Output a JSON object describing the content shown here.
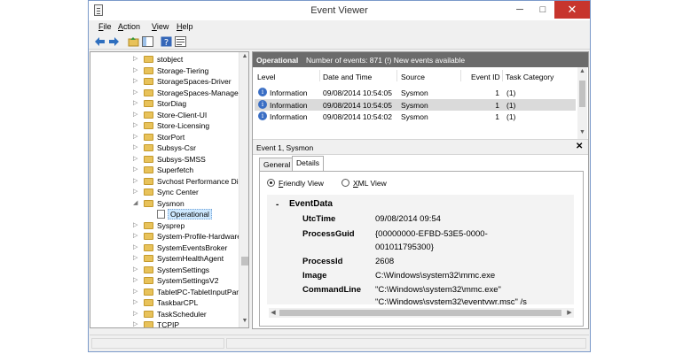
{
  "window": {
    "title": "Event Viewer",
    "controls": {
      "minimize": "─",
      "maximize": "□",
      "close": "✕"
    }
  },
  "menu": [
    {
      "label": "File",
      "accel": "F"
    },
    {
      "label": "Action",
      "accel": "A"
    },
    {
      "label": "View",
      "accel": "V"
    },
    {
      "label": "Help",
      "accel": "H"
    }
  ],
  "toolbar": [
    "back-icon",
    "forward-icon",
    "up-folder-icon",
    "show-hide-tree-icon",
    "help-icon",
    "properties-icon"
  ],
  "tree": {
    "items": [
      {
        "label": "stobject"
      },
      {
        "label": "Storage-Tiering"
      },
      {
        "label": "StorageSpaces-Driver"
      },
      {
        "label": "StorageSpaces-Managem"
      },
      {
        "label": "StorDiag"
      },
      {
        "label": "Store-Client-UI"
      },
      {
        "label": "Store-Licensing"
      },
      {
        "label": "StorPort"
      },
      {
        "label": "Subsys-Csr"
      },
      {
        "label": "Subsys-SMSS"
      },
      {
        "label": "Superfetch"
      },
      {
        "label": "Svchost Performance Dia"
      },
      {
        "label": "Sync Center"
      },
      {
        "label": "Sysmon",
        "expanded": true
      },
      {
        "label": "Operational",
        "selected": true,
        "child": true
      },
      {
        "label": "Sysprep"
      },
      {
        "label": "System-Profile-Hardware"
      },
      {
        "label": "SystemEventsBroker"
      },
      {
        "label": "SystemHealthAgent"
      },
      {
        "label": "SystemSettings"
      },
      {
        "label": "SystemSettingsV2"
      },
      {
        "label": "TabletPC-TabletInputPan"
      },
      {
        "label": "TaskbarCPL"
      },
      {
        "label": "TaskScheduler"
      },
      {
        "label": "TCPIP"
      }
    ]
  },
  "log_header": {
    "title": "Operational",
    "info": "Number of events: 871 (!) New events available"
  },
  "columns": [
    "Level",
    "Date and Time",
    "Source",
    "Event ID",
    "Task Category"
  ],
  "events": [
    {
      "level": "Information",
      "datetime": "09/08/2014 10:54:05",
      "source": "Sysmon",
      "event_id": "1",
      "task": "(1)"
    },
    {
      "level": "Information",
      "datetime": "09/08/2014 10:54:05",
      "source": "Sysmon",
      "event_id": "1",
      "task": "(1)"
    },
    {
      "level": "Information",
      "datetime": "09/08/2014 10:54:02",
      "source": "Sysmon",
      "event_id": "1",
      "task": "(1)"
    }
  ],
  "detail": {
    "title": "Event 1, Sysmon",
    "close": "✕",
    "tabs": [
      {
        "label": "General"
      },
      {
        "label": "Details",
        "active": true
      }
    ],
    "views": [
      {
        "label": "Friendly View",
        "accel": "F",
        "selected": true
      },
      {
        "label": "XML View",
        "accel": "X",
        "selected": false
      }
    ],
    "eventdata": {
      "title": "EventData",
      "toggle": "-",
      "fields": [
        {
          "key": "UtcTime",
          "value": "09/08/2014 09:54"
        },
        {
          "key": "ProcessGuid",
          "value": "{00000000-EFBD-53E5-0000-",
          "value2": "001011795300}"
        },
        {
          "key": "ProcessId",
          "value": "2608"
        },
        {
          "key": "Image",
          "value": "C:\\Windows\\system32\\mmc.exe"
        },
        {
          "key": "CommandLine",
          "value": "\"C:\\Windows\\system32\\mmc.exe\"",
          "value2": "\"C:\\Windows\\system32\\eventvwr.msc\" /s"
        }
      ]
    }
  }
}
